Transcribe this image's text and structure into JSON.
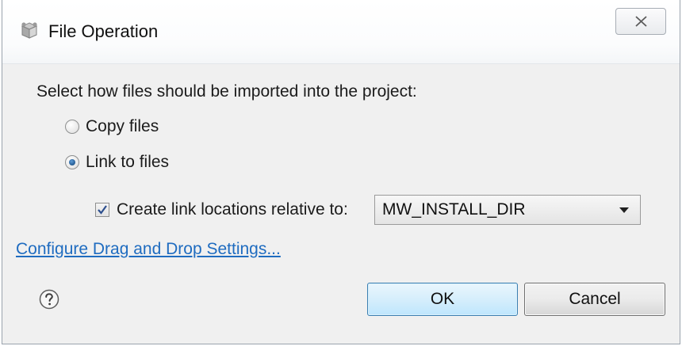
{
  "window": {
    "title": "File Operation",
    "close_icon": "close-icon",
    "app_icon": "gear-box-icon"
  },
  "prompt": "Select how files should be imported into the project:",
  "options": [
    {
      "label": "Copy files",
      "selected": false
    },
    {
      "label": "Link to files",
      "selected": true
    }
  ],
  "relative": {
    "checkbox_label": "Create link locations relative to:",
    "checked": true,
    "selected_value": "MW_INSTALL_DIR"
  },
  "link": "Configure Drag and Drop Settings...",
  "buttons": {
    "ok": "OK",
    "cancel": "Cancel"
  },
  "colors": {
    "link": "#1f6cc0",
    "ok_border": "#3c7fb1"
  }
}
